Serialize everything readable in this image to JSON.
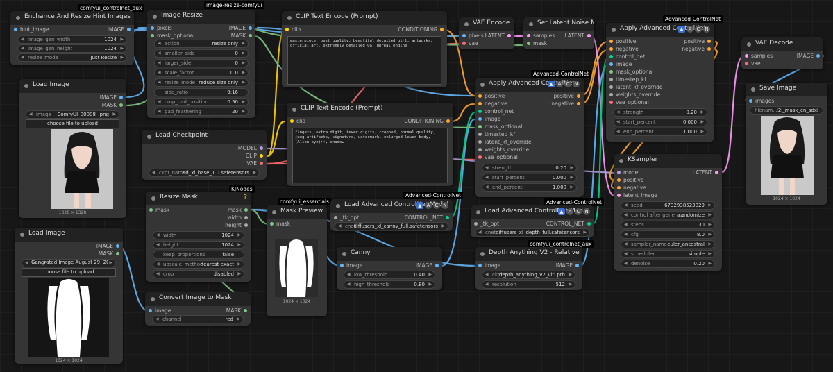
{
  "tags": {
    "controlnet_aux_1": "comfyui_controlnet_aux",
    "image_resize_pkg": "image-resize-comfyui",
    "advanced_cn_1": "Advanced-ControlNet",
    "advanced_cn_2": "Advanced-ControlNet",
    "advanced_cn_3": "Advanced-ControlNet",
    "advanced_cn_4": "Advanced-ControlNet",
    "kjnodes": "KJNodes",
    "essentials": "comfyui_essentials",
    "controlnet_aux_2": "comfyui_controlnet_aux"
  },
  "nodes": {
    "enhance": {
      "title": "Enchance And Resize Hint Images",
      "in_hint": "hint_image",
      "out_image": "IMAGE",
      "w_width_l": "image_gen_width",
      "w_width_v": "1024",
      "w_height_l": "image_gen_height",
      "w_height_v": "1024",
      "w_mode_l": "resize_mode",
      "w_mode_v": "Just Resize"
    },
    "image_resize": {
      "title": "Image Resize",
      "in_pixels": "pixels",
      "in_mask": "mask_optional",
      "out_image": "IMAGE",
      "out_mask": "MASK",
      "action_l": "action",
      "action_v": "resize only",
      "smaller_l": "smaller_side",
      "smaller_v": "0",
      "larger_l": "larger_side",
      "larger_v": "0",
      "scale_l": "scale_factor",
      "scale_v": "0.0",
      "rmode_l": "resize_mode",
      "rmode_v": "reduce size only",
      "ratio_l": "side_ratio",
      "ratio_v": "9:16",
      "crop_l": "crop_pad_position",
      "crop_v": "0.50",
      "feather_l": "pad_feathering",
      "feather_v": "20"
    },
    "load_image_1": {
      "title": "Load Image",
      "out_image": "IMAGE",
      "out_mask": "MASK",
      "image_l": "image",
      "image_v": "ComfyUI_00008_.png",
      "upload": "choose file to upload",
      "dims": "1328 × 1328"
    },
    "load_checkpoint": {
      "title": "Load Checkpoint",
      "out_model": "MODEL",
      "out_clip": "CLIP",
      "out_vae": "VAE",
      "ckpt_l": "ckpt_name",
      "ckpt_v": "sd_xl_base_1.0.safetensors"
    },
    "clip_pos": {
      "title": "CLIP Text Encode (Prompt)",
      "in_clip": "clip",
      "out": "CONDITIONING",
      "text": "masterpiece, best quality, beautiful detailed girl, artworks, official art, extremely detailed CG, unreal engine"
    },
    "clip_neg": {
      "title": "CLIP Text Encode (Prompt)",
      "in_clip": "clip",
      "out": "CONDITIONING",
      "text": "fingers, extra digit, fewer digits, cropped, normal quality, jpeg artifacts, signature, watermark, enlarged lower body, (Alien eye)++, shadow"
    },
    "vae_encode": {
      "title": "VAE Encode",
      "in_pixels": "pixels",
      "in_vae": "vae",
      "out": "LATENT"
    },
    "noise_mask": {
      "title": "Set Latent Noise Mask",
      "in_samples": "samples",
      "in_mask": "mask",
      "out": "LATENT"
    },
    "acn_1": {
      "title": "Apply Advanced ControlNet",
      "in_pos": "positive",
      "in_neg": "negative",
      "in_cn": "control_net",
      "in_image": "image",
      "in_mask": "mask_optional",
      "in_ts": "timestep_kf",
      "in_lkf": "latent_kf_override",
      "in_wo": "weights_override",
      "in_vae": "vae_optional",
      "out_pos": "positive",
      "out_neg": "negative",
      "strength_l": "strength",
      "strength_v": "0.20",
      "start_l": "start_percent",
      "start_v": "0.000",
      "end_l": "end_percent",
      "end_v": "1.000"
    },
    "acn_2": {
      "title": "Apply Advanced ControlNet",
      "in_pos": "positive",
      "in_neg": "negative",
      "in_cn": "control_net",
      "in_image": "image",
      "in_mask": "mask_optional",
      "in_ts": "timestep_kf",
      "in_lkf": "latent_kf_override",
      "in_wo": "weights_override",
      "in_vae": "vae_optional",
      "out_pos": "positive",
      "out_neg": "negative",
      "strength_l": "strength",
      "strength_v": "0.20",
      "start_l": "start_percent",
      "start_v": "0.000",
      "end_l": "end_percent",
      "end_v": "1.000"
    },
    "vae_decode": {
      "title": "VAE Decode",
      "in_samples": "samples",
      "in_vae": "vae",
      "out": "IMAGE"
    },
    "save_image": {
      "title": "Save Image",
      "in_images": "images",
      "fn_l": "filenam...",
      "fn_v": "l2i_mask_cn_sdxl",
      "dims": "1024 × 1024"
    },
    "ksampler": {
      "title": "KSampler",
      "in_model": "model",
      "in_pos": "positive",
      "in_neg": "negative",
      "in_latent": "latent_image",
      "out": "LATENT",
      "seed_l": "seed",
      "seed_v": "6732938523029",
      "cag_l": "control after generate",
      "cag_v": "randomize",
      "steps_l": "steps",
      "steps_v": "30",
      "cfg_l": "cfg",
      "cfg_v": "8.0",
      "sampler_l": "sampler_name",
      "sampler_v": "euler_ancestral",
      "sched_l": "scheduler",
      "sched_v": "simple",
      "denoise_l": "denoise",
      "denoise_v": "0.20"
    },
    "resize_mask": {
      "title": "Resize Mask",
      "in_mask": "mask",
      "out_mask": "mask",
      "out_width": "width",
      "out_height": "height",
      "w_l": "width",
      "w_v": "1024",
      "h_l": "height",
      "h_v": "1024",
      "kp_l": "keep_proportions",
      "kp_v": "false",
      "up_l": "upscale_method",
      "up_v": "nearest-exact",
      "crop_l": "crop",
      "crop_v": "disabled",
      "qmark": "?"
    },
    "mask_preview": {
      "title": "Mask Preview",
      "in_mask": "mask",
      "dims": "1024 × 1024"
    },
    "load_cn_canny": {
      "title": "Load Advanced ControlNet Model",
      "in_tk": "_tk_opt",
      "out": "CONTROL_NET",
      "cnet_l": "cnet",
      "cnet_v": "diffusers_xl_canny_full.safetensors"
    },
    "load_cn_depth": {
      "title": "Load Advanced ControlNet Model",
      "in_tk": "_tk_opt",
      "out": "CONTROL_NET",
      "cnet_l": "cnet",
      "cnet_v": "diffusers_xl_depth_full.safetensors"
    },
    "load_image_2": {
      "title": "Load Image",
      "out_image": "IMAGE",
      "out_mask": "MASK",
      "image_l": "image",
      "image_v": "Generated Image August 29, 202 ...",
      "upload": "choose file to upload",
      "dims": "1024 × 1024"
    },
    "convert_mask": {
      "title": "Convert Image to Mask",
      "in_image": "image",
      "out": "MASK",
      "ch_l": "channel",
      "ch_v": "red"
    },
    "canny": {
      "title": "Canny",
      "in_image": "image",
      "out": "IMAGE",
      "low_l": "low_threshold",
      "low_v": "0.40",
      "high_l": "high_threshold",
      "high_v": "0.80"
    },
    "depth": {
      "title": "Depth Anything V2 - Relative",
      "in_image": "image",
      "out": "IMAGE",
      "ckpt_l": "ckpt_n...",
      "ckpt_v": "depth_anything_v2_vitl.pth",
      "res_l": "resolution",
      "res_v": "512"
    }
  },
  "colors": {
    "wire_image": "#64b5f6",
    "wire_mask": "#81c784",
    "wire_clip": "#ffd500",
    "wire_cond": "#ffa931",
    "wire_vae": "#ff6e6e",
    "wire_latent": "#ff9cf9",
    "wire_model": "#b39ddb",
    "wire_cn": "#00d78d"
  }
}
